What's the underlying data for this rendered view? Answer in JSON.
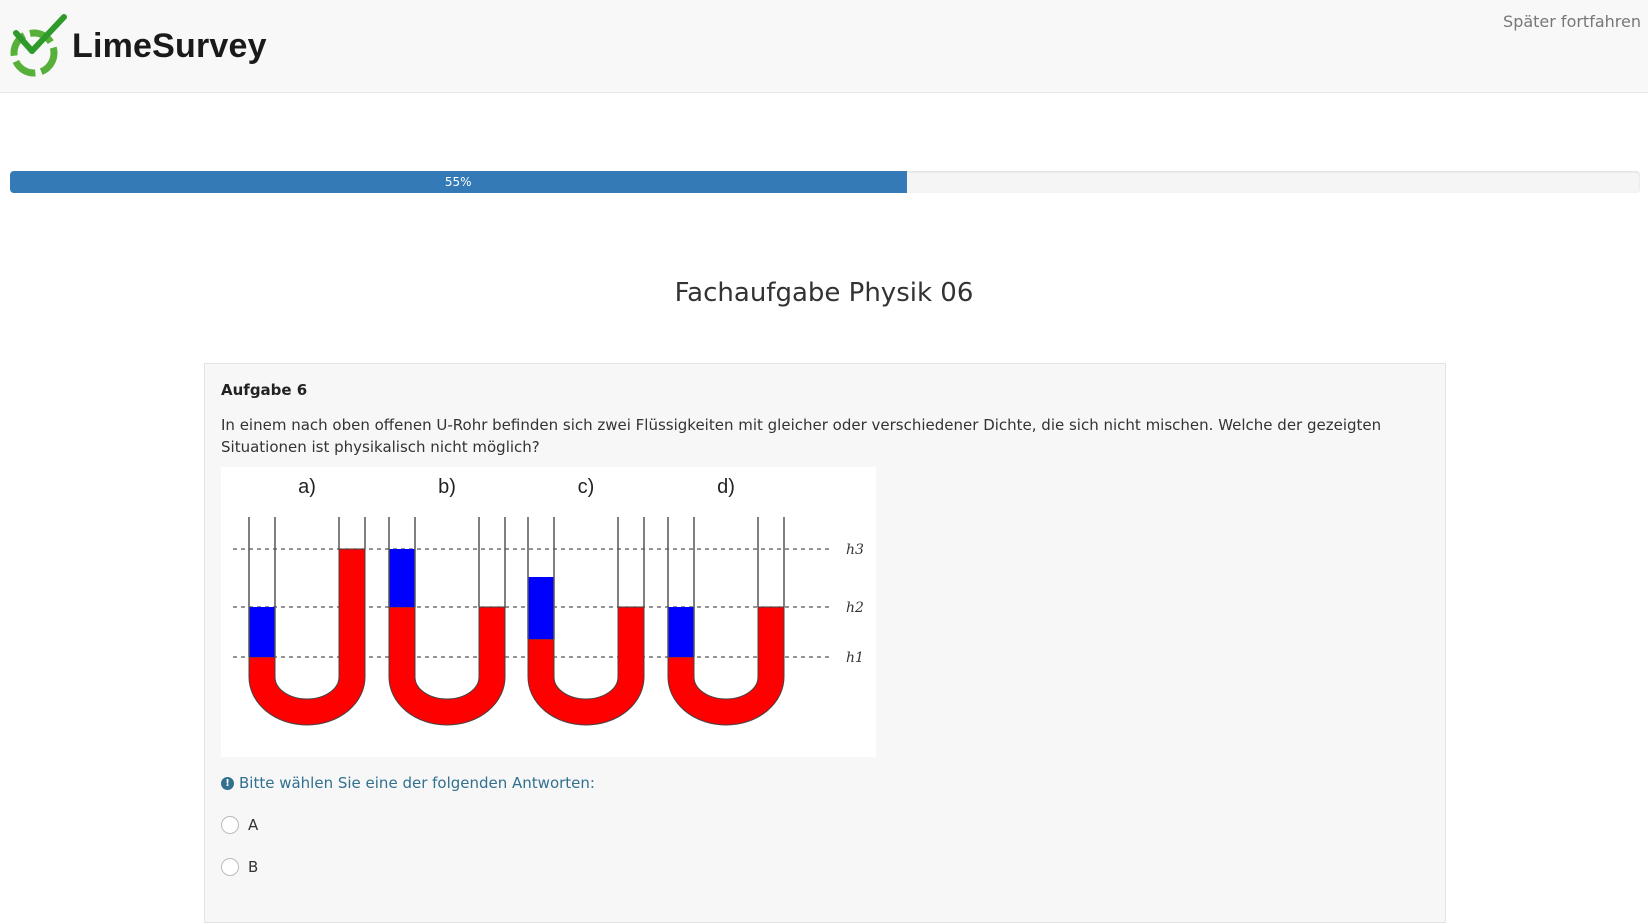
{
  "header": {
    "brand": "LimeSurvey",
    "later_link": "Später fortfahren",
    "logo_icon": "limesurvey-logo-icon"
  },
  "progress": {
    "label": "55%",
    "value": 55,
    "color": "#337ab7"
  },
  "group": {
    "title": "Fachaufgabe Physik 06"
  },
  "question": {
    "code": "Aufgabe 6",
    "text": "In einem nach oben offenen U-Rohr befinden sich zwei Flüssigkeiten mit gleicher oder verschiedener Dichte, die sich nicht mischen. Welche der gezeigten Situationen ist physikalisch nicht möglich?",
    "figure": {
      "labels": [
        "a)",
        "b)",
        "c)",
        "d)"
      ],
      "level_labels": [
        "h3",
        "h2",
        "h1"
      ],
      "colors": {
        "dense": "#ff0000",
        "light": "#0000ff"
      }
    },
    "help": "Bitte wählen Sie eine der folgenden Antworten:",
    "help_icon": "exclamation-circle-icon",
    "answers": [
      {
        "label": "A"
      },
      {
        "label": "B"
      }
    ]
  }
}
